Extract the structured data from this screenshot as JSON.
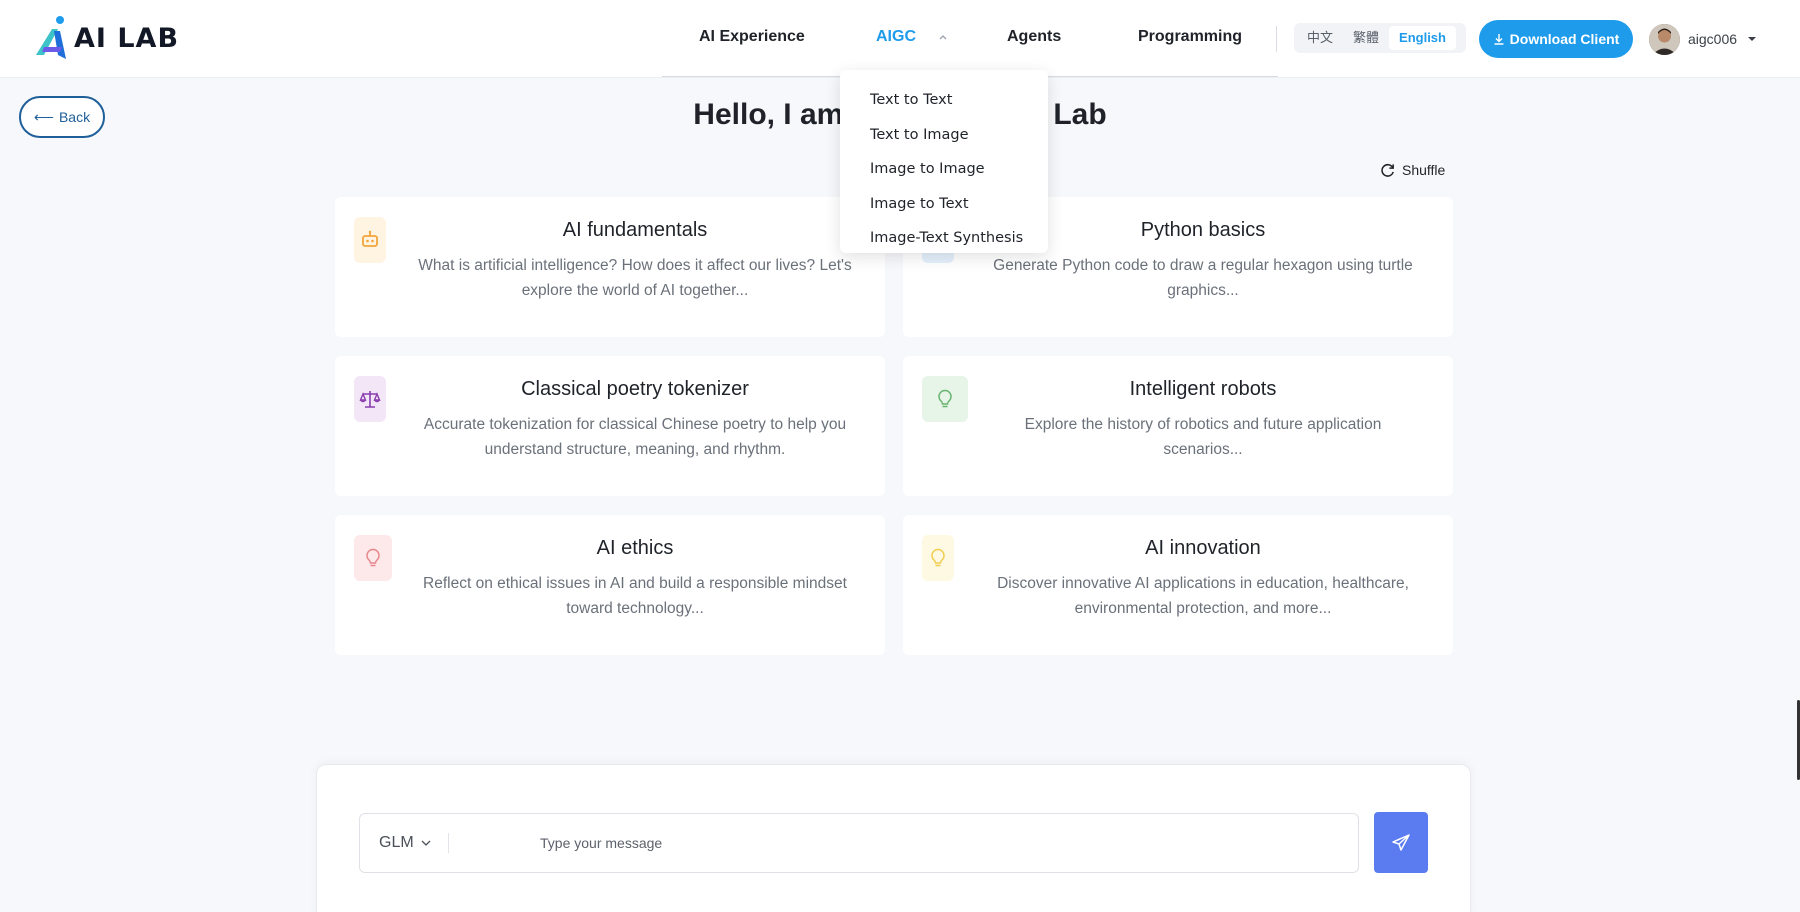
{
  "app": {
    "logo_text": "AI LAB"
  },
  "nav": {
    "items": [
      {
        "label": "AI Experience",
        "active": false
      },
      {
        "label": "AIGC",
        "active": true
      },
      {
        "label": "Agents",
        "active": false
      },
      {
        "label": "Programming",
        "active": false
      }
    ]
  },
  "languages": {
    "options": [
      "中文",
      "繁體",
      "English"
    ],
    "selected": "English"
  },
  "download": {
    "label": "Download Client"
  },
  "user": {
    "name": "aigc006"
  },
  "back": {
    "label": "Back"
  },
  "greeting": {
    "visible_left": "Hello, I am",
    "visible_right": "Lab"
  },
  "shuffle": {
    "label": "Shuffle"
  },
  "aigc_menu": {
    "items": [
      "Text to Text",
      "Text to Image",
      "Image to Image",
      "Image to Text",
      "Image-Text Synthesis"
    ]
  },
  "cards": [
    {
      "title": "AI fundamentals",
      "desc": "What is artificial intelligence? How does it affect our lives? Let's explore the world of AI together...",
      "icon": "robot-icon",
      "icon_color": "#f2a53a",
      "icon_bg": "#fff3e2"
    },
    {
      "title": "Python basics",
      "desc": "Generate Python code to draw a regular hexagon using turtle graphics...",
      "icon": "code-icon",
      "icon_color": "#3a8ee6",
      "icon_bg": "#e4f0fc"
    },
    {
      "title": "Classical poetry tokenizer",
      "desc": "Accurate tokenization for classical Chinese poetry to help you understand structure, meaning, and rhythm.",
      "icon": "scales-icon",
      "icon_color": "#8a3fb0",
      "icon_bg": "#f3e6f7"
    },
    {
      "title": "Intelligent robots",
      "desc": "Explore the history of robotics and future application scenarios...",
      "icon": "lightbulb-icon",
      "icon_color": "#67b46e",
      "icon_bg": "#e7f5e8"
    },
    {
      "title": "AI ethics",
      "desc": "Reflect on ethical issues in AI and build a responsible mindset toward technology...",
      "icon": "lightbulb-icon",
      "icon_color": "#e8868d",
      "icon_bg": "#fde8ea"
    },
    {
      "title": "AI innovation",
      "desc": "Discover innovative AI applications in education, healthcare, environmental protection, and more...",
      "icon": "lightbulb-icon",
      "icon_color": "#f2cc4f",
      "icon_bg": "#fef9e2"
    }
  ],
  "chat": {
    "model": "GLM",
    "placeholder": "Type your message"
  },
  "colors": {
    "accent": "#1e9bea",
    "send": "#5b7bf0",
    "back_border": "#1f5f9a"
  }
}
